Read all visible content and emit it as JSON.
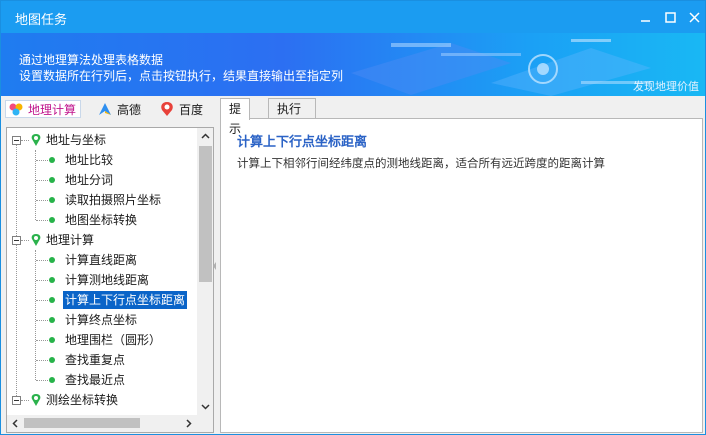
{
  "window": {
    "title": "地图任务"
  },
  "banner": {
    "line1": "通过地理算法处理表格数据",
    "line2": "设置数据所在行列后，点击按钮执行，结果直接输出至指定列",
    "corner_text": "发现地理价值"
  },
  "toolbar": {
    "items": [
      {
        "label": "地理计算",
        "icon": "geo-calc-icon",
        "active": true
      },
      {
        "label": "高德",
        "icon": "gaode-logo-icon",
        "active": false
      },
      {
        "label": "百度",
        "icon": "baidu-logo-icon",
        "active": false
      }
    ]
  },
  "tree": {
    "groups": [
      {
        "label": "地址与坐标",
        "items": [
          "地址比较",
          "地址分词",
          "读取拍摄照片坐标",
          "地图坐标转换"
        ]
      },
      {
        "label": "地理计算",
        "items": [
          "计算直线距离",
          "计算测地线距离",
          "计算上下行点坐标距离",
          "计算终点坐标",
          "地理围栏（圆形）",
          "查找重复点",
          "查找最近点"
        ]
      },
      {
        "label": "测绘坐标转换",
        "items": []
      }
    ],
    "selected": "计算上下行点坐标距离"
  },
  "tabs": [
    {
      "label": "提示",
      "active": true
    },
    {
      "label": "执行",
      "active": false
    }
  ],
  "content": {
    "heading": "计算上下行点坐标距离",
    "description": "计算上下相邻行间经纬度点的测地线距离，适合所有远近跨度的距离计算"
  },
  "colors": {
    "titlebar": "#1b9cf1",
    "accent_blue": "#2b63c6",
    "selection": "#0a64c8",
    "tree_dot": "#27b34a"
  }
}
